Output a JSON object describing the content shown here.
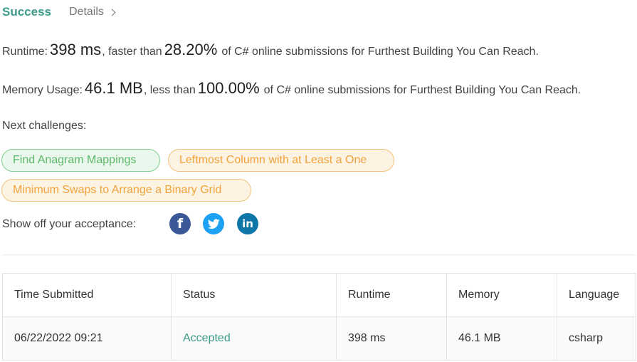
{
  "header": {
    "status": "Success",
    "details_label": "Details"
  },
  "runtime": {
    "label": "Runtime:",
    "value": "398 ms",
    "comparison": ", faster than",
    "percent": "28.20%",
    "suffix": "of C# online submissions for Furthest Building You Can Reach."
  },
  "memory": {
    "label": "Memory Usage:",
    "value": "46.1 MB",
    "comparison": ", less than",
    "percent": "100.00%",
    "suffix": "of C# online submissions for Furthest Building You Can Reach."
  },
  "next_challenges": {
    "label": "Next challenges:",
    "items": [
      {
        "label": "Find Anagram Mappings",
        "difficulty_color": "#5cb86b"
      },
      {
        "label": "Leftmost Column with at Least a One",
        "difficulty_color": "#f0a33c"
      },
      {
        "label": "Minimum Swaps to Arrange a Binary Grid",
        "difficulty_color": "#f0a33c"
      }
    ]
  },
  "share": {
    "label": "Show off your acceptance:",
    "icons": [
      "facebook-icon",
      "twitter-icon",
      "linkedin-icon"
    ]
  },
  "table": {
    "columns": [
      "Time Submitted",
      "Status",
      "Runtime",
      "Memory",
      "Language"
    ],
    "rows": [
      {
        "time": "06/22/2022 09:21",
        "status": "Accepted",
        "runtime": "398 ms",
        "memory": "46.1 MB",
        "language": "csharp"
      }
    ]
  },
  "colors": {
    "accent": "#3c9c8a",
    "easy": "#5cb86b",
    "medium": "#f0a33c",
    "facebook": "#3b5998",
    "twitter": "#1da1f2",
    "linkedin": "#0e76a8"
  }
}
